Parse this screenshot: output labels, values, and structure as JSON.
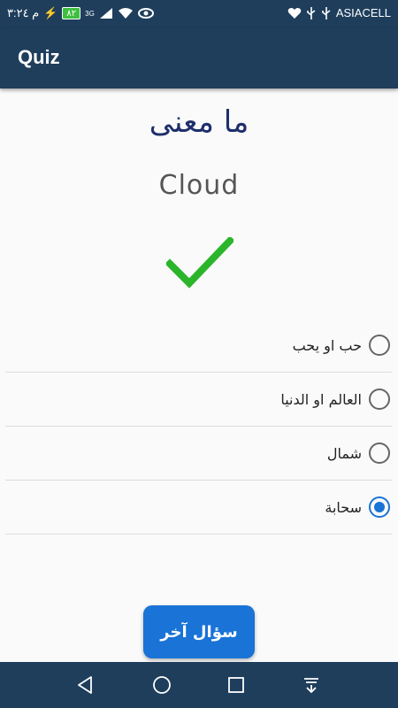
{
  "status_bar": {
    "time": "م ٣:٢٤",
    "battery": "٨٢",
    "signal_label": "3G",
    "carrier": "ASIACELL"
  },
  "app_bar": {
    "title": "Quiz"
  },
  "quiz": {
    "question": "ما معنى",
    "word": "Cloud",
    "result_icon": "checkmark-icon",
    "result_color": "#2bb52b",
    "options": [
      {
        "label": "حب او يحب",
        "selected": false
      },
      {
        "label": "العالم او الدنيا",
        "selected": false
      },
      {
        "label": "شمال",
        "selected": false
      },
      {
        "label": "سحابة",
        "selected": true
      }
    ],
    "next_button": "سؤال آخر"
  },
  "nav_bar": {
    "icons": [
      "back-icon",
      "home-icon",
      "recents-icon",
      "notification-pull-icon"
    ]
  },
  "colors": {
    "primary_dark": "#1e3e5c",
    "accent": "#1a73d6",
    "question_text": "#1e2f6b"
  }
}
